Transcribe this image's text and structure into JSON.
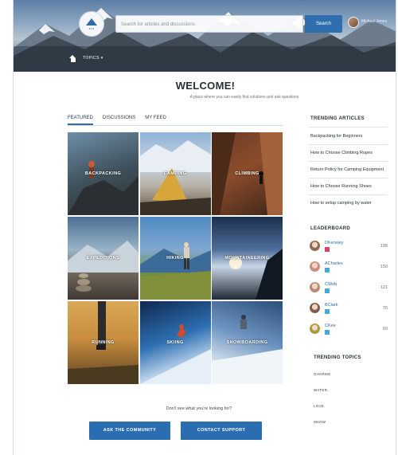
{
  "header": {
    "logo_text": "ero",
    "search_placeholder": "Search for articles and discussions",
    "search_button": "Search",
    "user_name": "Michael Jones",
    "nav_topics": "TOPICS ▾"
  },
  "welcome": {
    "title": "WELCOME!",
    "subtitle": "A place where you can easily find solutions and ask questions"
  },
  "tabs": [
    "FEATURED",
    "DISCUSSIONS",
    "MY FEED"
  ],
  "tiles": [
    "BACKPACKING",
    "CAMPING",
    "CLIMBING",
    "EXPEDITIONS",
    "HIKING",
    "MOUNTAINEERING",
    "RUNNING",
    "SKIING",
    "SNOWBOARDING"
  ],
  "cta": {
    "text": "Don't see what you're looking for?",
    "ask": "ASK THE COMMUNITY",
    "contact": "CONTACT SUPPORT"
  },
  "sidebar": {
    "trending_articles_title": "TRENDING ARTICLES",
    "articles": [
      "Backpacking for Beginners",
      "How to Choose Climbing Ropes",
      "Return Policy for Camping Equipment",
      "How to Choose Running Shoes",
      "How to setup camping by water"
    ],
    "leaderboard_title": "LEADERBOARD",
    "leaders": [
      {
        "name": "DKensley",
        "score": "195",
        "badge": "red",
        "avatar_color": "#8a6a55"
      },
      {
        "name": "ACharles",
        "score": "150",
        "badge": "blue",
        "avatar_color": "#c98d84"
      },
      {
        "name": "CWeb",
        "score": "121",
        "badge": "blue",
        "avatar_color": "#b98a78"
      },
      {
        "name": "BClark",
        "score": "76",
        "badge": "blue",
        "avatar_color": "#7f5f4c"
      },
      {
        "name": "CKee",
        "score": "60",
        "badge": "blue",
        "avatar_color": "#a89c3c"
      }
    ],
    "trending_topics_title": "TRENDING TOPICS",
    "topics": [
      "CHARMS",
      "WATER",
      "LOVE",
      "SNOW"
    ]
  },
  "colors": {
    "accent": "#2e6ca8",
    "button": "#2a6db0"
  }
}
